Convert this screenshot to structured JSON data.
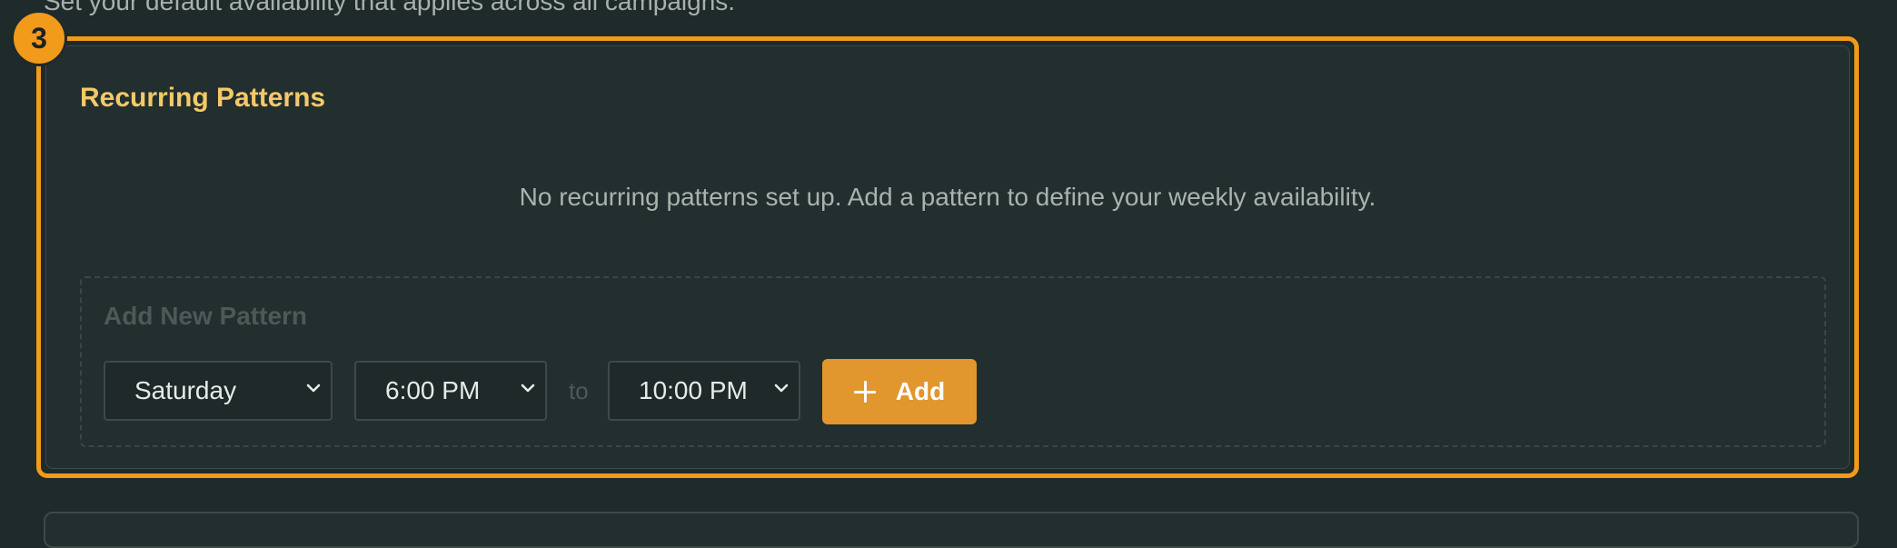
{
  "page": {
    "description": "Set your default availability that applies across all campaigns."
  },
  "section": {
    "step_number": "3",
    "title": "Recurring Patterns",
    "empty_message": "No recurring patterns set up. Add a pattern to define your weekly availability."
  },
  "add_pattern": {
    "title": "Add New Pattern",
    "day": "Saturday",
    "start_time": "6:00 PM",
    "to_label": "to",
    "end_time": "10:00 PM",
    "add_label": "Add"
  },
  "colors": {
    "accent": "#f29a1a",
    "title": "#f3c969",
    "button": "#e1962e",
    "background": "#1f2a2a",
    "card": "#232e2e"
  },
  "icons": {
    "chevron": "chevron-down-icon",
    "add": "plus-icon"
  }
}
